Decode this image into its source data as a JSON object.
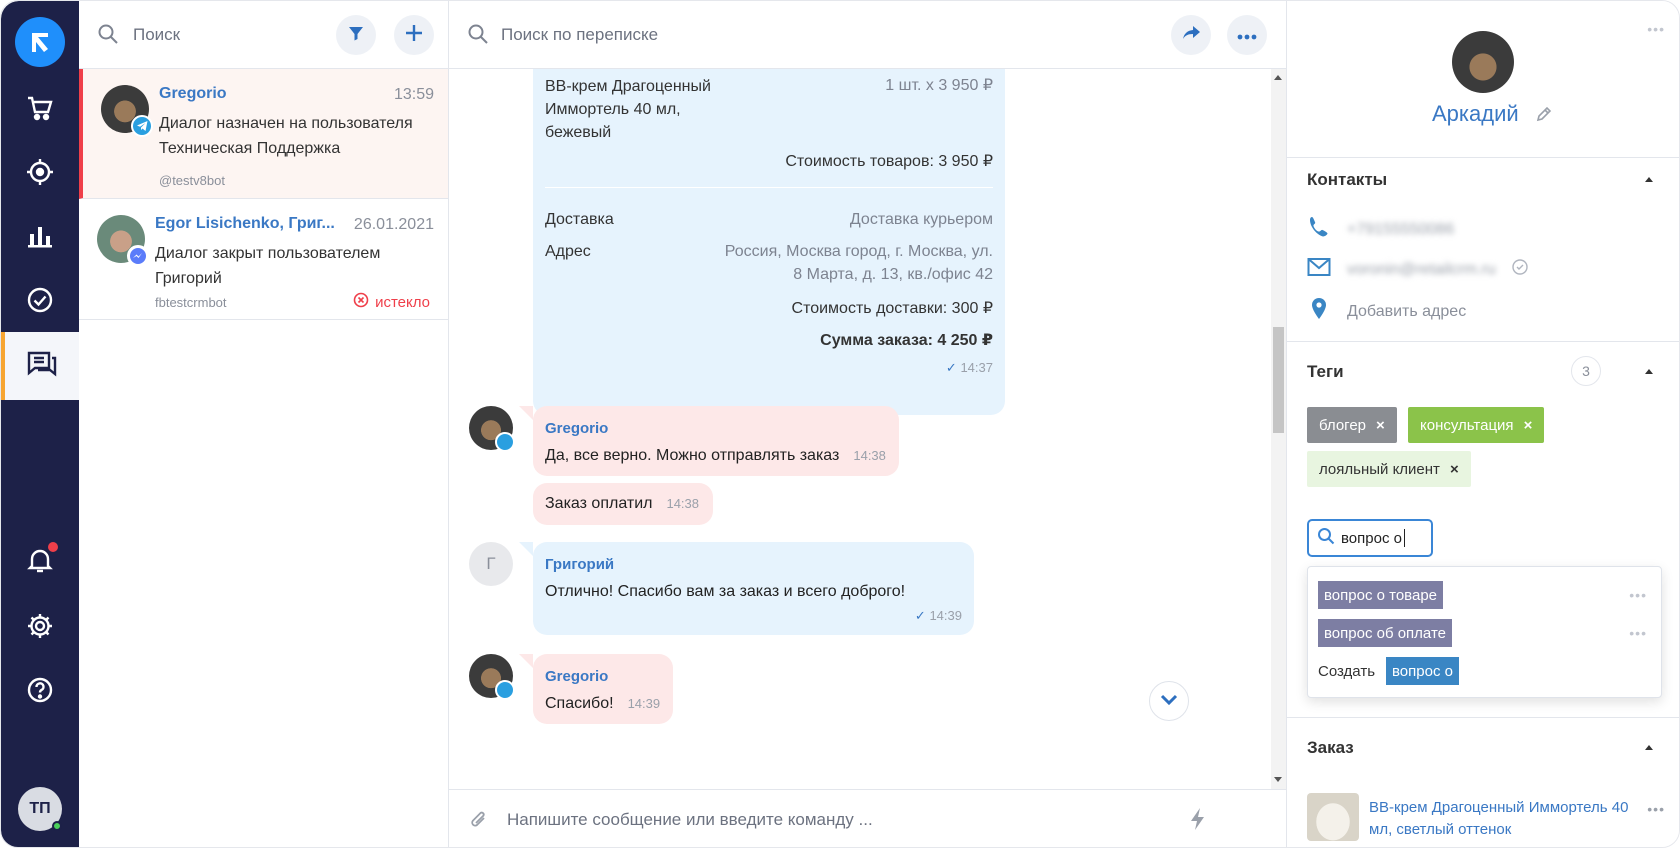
{
  "colors": {
    "nav_bg": "#1d2148",
    "accent_blue": "#3a78c4",
    "active_orange": "#f7a531",
    "alert_red": "#ef3f4a",
    "tag_grey": "#8a8d92",
    "tag_green": "#8bc34a",
    "tag_light_green": "#e8f5e0",
    "dropdown_tag": "#7d7ea3",
    "create_tag": "#3a86c4"
  },
  "nav": {
    "items": [
      "cart-icon",
      "target-icon",
      "chart-icon",
      "check-circle-icon",
      "chat-icon"
    ],
    "bottom": [
      "bell-icon",
      "gear-icon",
      "help-icon"
    ],
    "avatar_initials": "ТП"
  },
  "list": {
    "search_placeholder": "Поиск",
    "dialogs": [
      {
        "name": "Gregorio",
        "time": "13:59",
        "message": "Диалог назначен на пользователя Техническая Поддержка",
        "bot": "@testv8bot",
        "channel": "telegram"
      },
      {
        "name": "Egor Lisichenko, Григ...",
        "time": "26.01.2021",
        "message": "Диалог закрыт пользователем Григорий",
        "bot": "fbtestcrmbot",
        "status": "истекло",
        "channel": "messenger"
      }
    ]
  },
  "chat": {
    "search_placeholder": "Поиск по переписке",
    "order": {
      "product": "BB-крем Драгоценный Иммортель 40 мл, бежевый",
      "qty_price": "1 шт. x 3 950 ₽",
      "goods_total": "Стоимость товаров: 3 950 ₽",
      "delivery_label": "Доставка",
      "delivery_value": "Доставка курьером",
      "address_label": "Адрес",
      "address_value_1": "Россия, Москва город, г. Москва, ул.",
      "address_value_2": "8 Марта, д. 13, кв./офис 42",
      "delivery_cost": "Стоимость доставки: 300 ₽",
      "order_total": "Сумма заказа: 4 250 ₽",
      "time": "14:37"
    },
    "messages": [
      {
        "author": "Gregorio",
        "text": "Да, все верно. Можно отправлять заказ",
        "time": "14:38"
      },
      {
        "text": "Заказ оплатил",
        "time": "14:38"
      },
      {
        "author": "Григорий",
        "avatar_letter": "Г",
        "text": "Отлично! Спасибо вам за заказ и всего доброго!",
        "time": "14:39"
      },
      {
        "author": "Gregorio",
        "text": "Спасибо!",
        "time": "14:39"
      }
    ],
    "composer_placeholder": "Напишите сообщение или введите команду ..."
  },
  "right": {
    "name": "Аркадий",
    "contacts_title": "Контакты",
    "phone": "+79155550086",
    "email": "voronin@retailcrm.ru",
    "add_address": "Добавить адрес",
    "tags_title": "Теги",
    "tags_count": "3",
    "tags": [
      {
        "label": "блогер"
      },
      {
        "label": "консультация"
      },
      {
        "label": "лояльный клиент"
      }
    ],
    "tag_input_value": "вопрос о",
    "dropdown": {
      "options": [
        "вопрос о товаре",
        "вопрос об оплате"
      ],
      "create_label": "Создать",
      "create_value": "вопрос о"
    },
    "order_title": "Заказ",
    "order_product": "BB-крем Драгоценный Иммортель 40 мл, светлый оттенок"
  }
}
